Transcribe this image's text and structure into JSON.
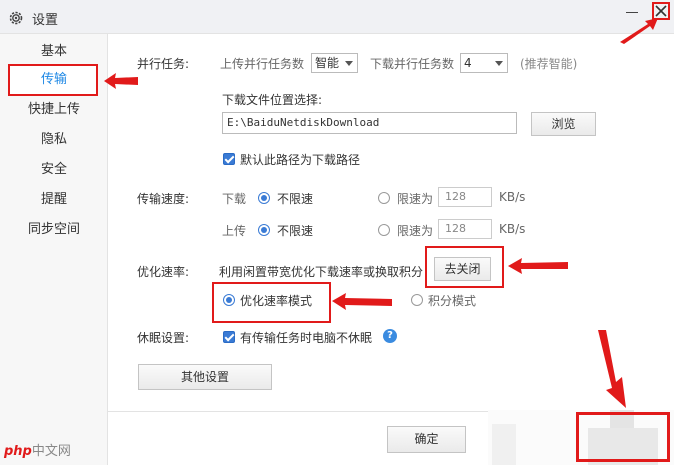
{
  "window": {
    "title": "设置",
    "minimize_icon": "minimize-icon",
    "close_icon": "close-icon"
  },
  "sidebar": {
    "items": [
      {
        "label": "基本"
      },
      {
        "label": "传输",
        "active": true
      },
      {
        "label": "快捷上传"
      },
      {
        "label": "隐私"
      },
      {
        "label": "安全"
      },
      {
        "label": "提醒"
      },
      {
        "label": "同步空间"
      }
    ]
  },
  "parallel": {
    "label": "并行任务:",
    "upload_label": "上传并行任务数",
    "upload_value": "智能",
    "download_label": "下载并行任务数",
    "download_value": "4",
    "hint": "(推荐智能)"
  },
  "download_location": {
    "label": "下载文件位置选择:",
    "path": "E:\\BaiduNetdiskDownload",
    "browse_label": "浏览",
    "default_checkbox_label": "默认此路径为下载路径",
    "default_checked": true
  },
  "speed": {
    "label": "传输速度:",
    "download": {
      "label": "下载",
      "unlimited_label": "不限速",
      "limit_label": "限速为",
      "limit_value": "128",
      "unit": "KB/s",
      "selected": "unlimited"
    },
    "upload": {
      "label": "上传",
      "unlimited_label": "不限速",
      "limit_label": "限速为",
      "limit_value": "128",
      "unit": "KB/s",
      "selected": "unlimited"
    }
  },
  "optimize": {
    "label": "优化速率:",
    "desc": "利用闲置带宽优化下载速率或换取积分",
    "toggle_button_label": "去关闭",
    "mode_rate_label": "优化速率模式",
    "mode_points_label": "积分模式",
    "selected": "rate"
  },
  "sleep": {
    "label": "休眠设置:",
    "checkbox_label": "有传输任务时电脑不休眠",
    "checked": true,
    "help_icon": "question-icon",
    "help_glyph": "?"
  },
  "other_settings_label": "其他设置",
  "footer": {
    "ok_label": "确定"
  },
  "watermark": {
    "brand": "php",
    "site": "中文网"
  },
  "colors": {
    "accent": "#3a7bd5",
    "active_nav": "#1e88e5",
    "annotation": "#e11a1a"
  }
}
